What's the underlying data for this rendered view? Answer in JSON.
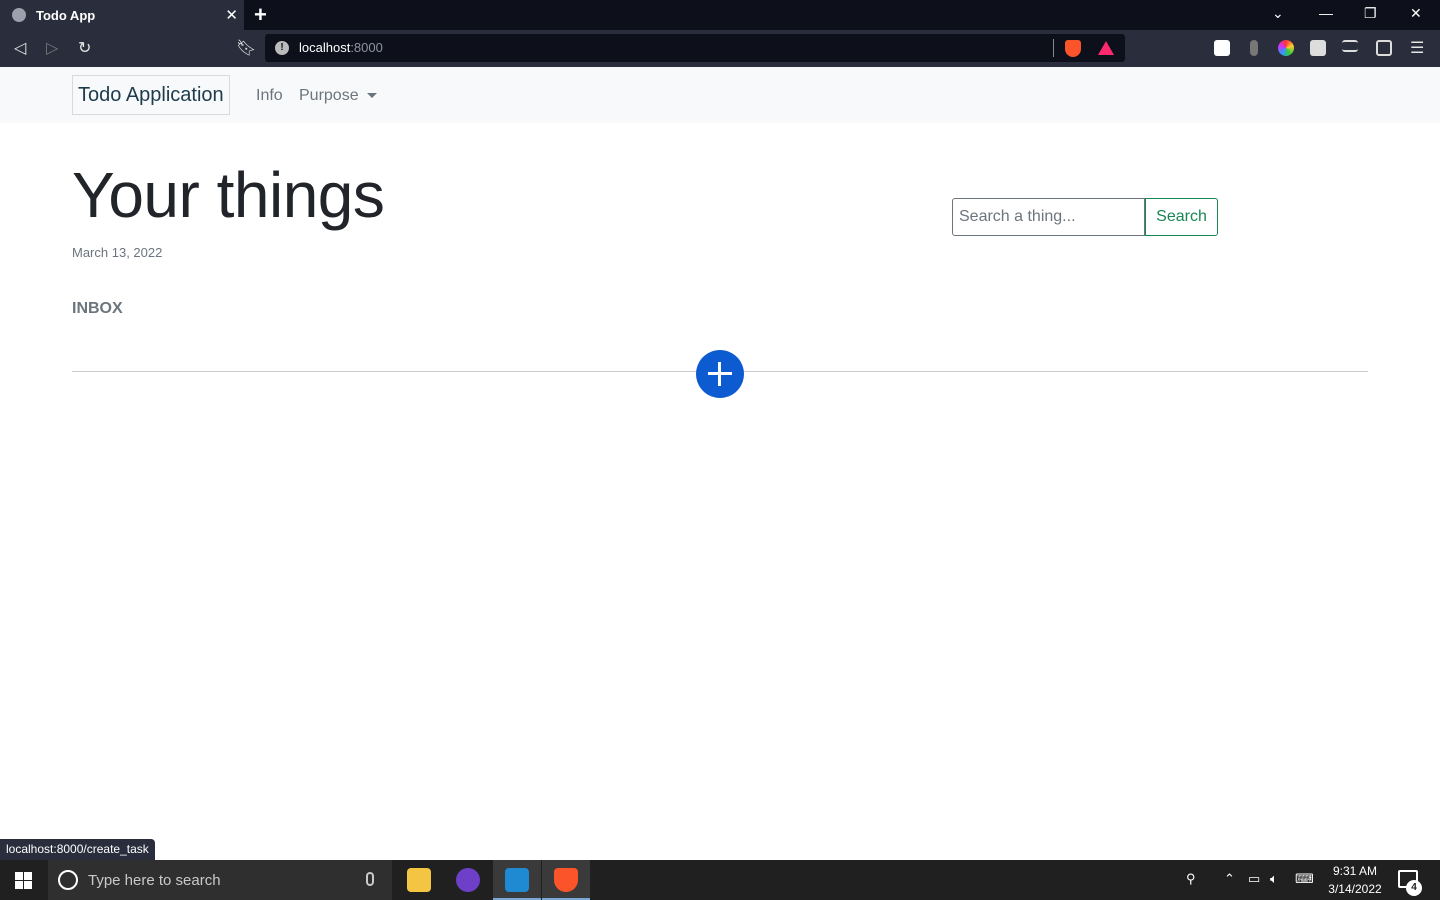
{
  "browser": {
    "tab_title": "Todo App",
    "tab_close": "✕",
    "new_tab": "+",
    "url_host": "localhost",
    "url_port": ":8000",
    "url_info": "!"
  },
  "navbar": {
    "brand": "Todo Application",
    "links": [
      {
        "label": "Info"
      },
      {
        "label": "Purpose"
      }
    ]
  },
  "main": {
    "title": "Your things",
    "date": "March 13, 2022",
    "search_placeholder": "Search a thing...",
    "search_button": "Search",
    "section_label": "INBOX"
  },
  "status_bar": {
    "link": "localhost:8000/create_task"
  },
  "taskbar": {
    "search_placeholder": "Type here to search",
    "time": "9:31 AM",
    "date": "3/14/2022",
    "notifications": "4"
  },
  "colors": {
    "add_button": "#0d5bd1",
    "search_button": "#198754",
    "navbar_bg": "#f8f9fa"
  }
}
